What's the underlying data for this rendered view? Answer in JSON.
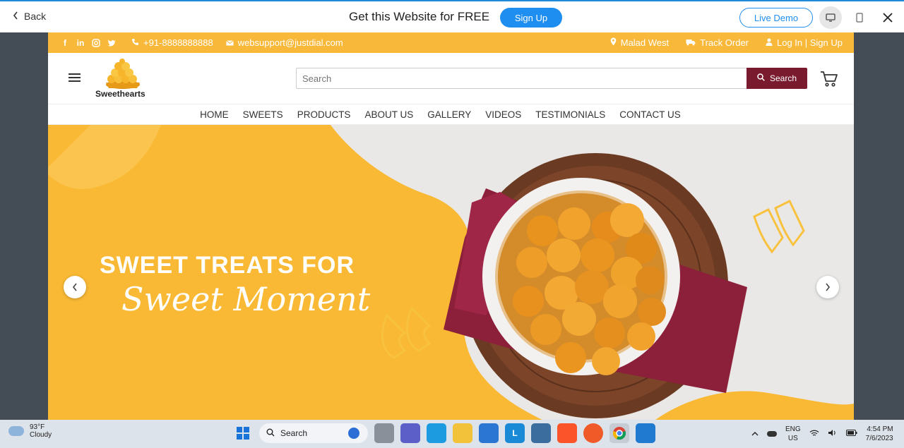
{
  "promo": {
    "back_label": "Back",
    "title": "Get this Website for FREE",
    "signup_label": "Sign Up",
    "demo_label": "Live Demo"
  },
  "topbar": {
    "social": [
      "facebook-icon",
      "linkedin-icon",
      "instagram-icon",
      "twitter-icon"
    ],
    "phone": "+91-8888888888",
    "email": "websupport@justdial.com",
    "location": "Malad West",
    "track": "Track Order",
    "login": "Log In | Sign Up"
  },
  "header": {
    "logo_text": "Sweethearts",
    "search_placeholder": "Search",
    "search_button": "Search"
  },
  "nav": {
    "items": [
      "HOME",
      "SWEETS",
      "PRODUCTS",
      "ABOUT US",
      "GALLERY",
      "VIDEOS",
      "TESTIMONIALS",
      "CONTACT US"
    ]
  },
  "hero": {
    "headline": "SWEET TREATS FOR",
    "script": "Sweet Moment"
  },
  "taskbar": {
    "temp": "93°F",
    "weather": "Cloudy",
    "search": "Search",
    "lang1": "ENG",
    "lang2": "US",
    "time": "4:54 PM",
    "date": "7/6/2023"
  },
  "colors": {
    "brand_yellow": "#f8b93a",
    "brand_maroon": "#7a1a2f",
    "promo_blue": "#1e8ef0"
  }
}
